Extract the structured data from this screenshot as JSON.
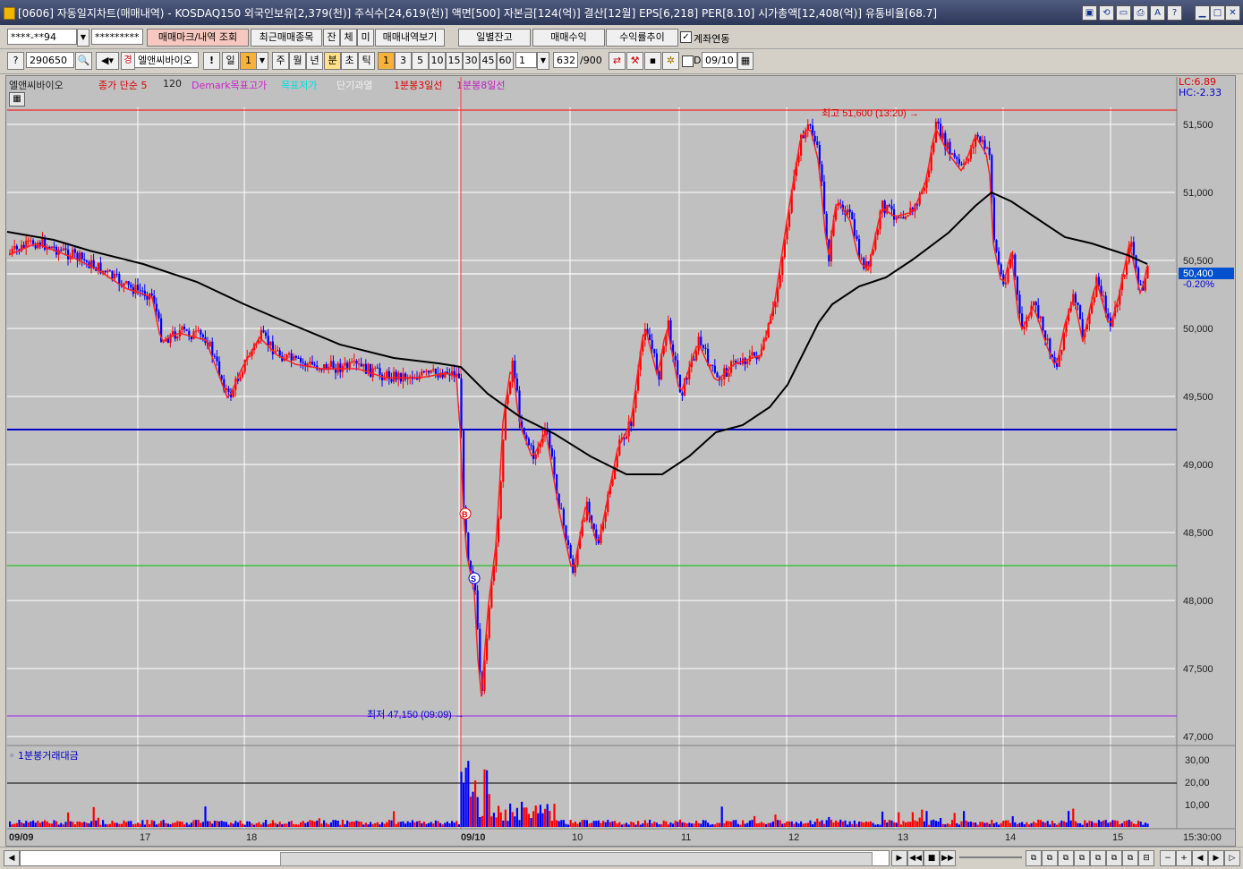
{
  "window": {
    "title": "[0606] 자동일지차트(매매내역) - KOSDAQ150 외국인보유[2,379(천)] 주식수[24,619(천)] 액면[500] 자본금[124(억)] 결산[12월] EPS[6,218] PER[8.10] 시가총액[12,408(억)] 유통비율[68.7]"
  },
  "toolbar1": {
    "account_value": "****-**94",
    "password_value": "*********",
    "btn_mark": "매매마크/내역 조회",
    "btn_recent": "최근매매종목",
    "btn_jan": "잔",
    "btn_che": "체",
    "btn_mi": "미",
    "btn_history": "매매내역보기",
    "btn_daily_balance": "일별잔고",
    "btn_trade_profit": "매매수익",
    "btn_return_trend": "수익률추이",
    "account_link_label": "계좌연동",
    "account_link_checked": "✓"
  },
  "toolbar2": {
    "code": "290650",
    "stock_name": "엘앤씨바이오",
    "periods": [
      "일",
      "1",
      "주",
      "월",
      "년",
      "분",
      "초",
      "틱"
    ],
    "minutes": [
      "1",
      "3",
      "5",
      "10",
      "15",
      "30",
      "45",
      "60"
    ],
    "interval_value": "1",
    "count_value": "632",
    "count_total": "/900",
    "d_label": "D",
    "date_value": "09/10"
  },
  "legend": [
    {
      "text": "엘앤씨바이오",
      "color": "#202020"
    },
    {
      "text": "종가 단순 5",
      "color": "#e00000"
    },
    {
      "text": "120",
      "color": "#202020"
    },
    {
      "text": "Demark목표고가",
      "color": "#d020d0"
    },
    {
      "text": "목표저가",
      "color": "#00e0e0"
    },
    {
      "text": "단기과열",
      "color": "#f0f0f0"
    },
    {
      "text": "1분봉3일선",
      "color": "#e00000"
    },
    {
      "text": "1분봉8일선",
      "color": "#c020c0"
    }
  ],
  "price_info": {
    "lc": "LC:6.89",
    "hc": "HC:-2.33",
    "current": "50,400",
    "change": "-0.20%"
  },
  "price_axis": [
    "51,500",
    "51,000",
    "50,500",
    "50,000",
    "49,500",
    "49,000",
    "48,500",
    "48,000",
    "47,500",
    "47,000"
  ],
  "annotations": {
    "high": "최고 51,600 (13:20)",
    "low": "최저 47,150 (09:09)",
    "buy_marker": "B",
    "sell_marker": "S"
  },
  "volume_panel": {
    "label": "1분봉거래대금",
    "axis": [
      "30,00",
      "20,00",
      "10,00"
    ]
  },
  "time_axis": [
    "09/09",
    "17",
    "18",
    "09/10",
    "10",
    "11",
    "12",
    "13",
    "14",
    "15"
  ],
  "end_time": "15:30:00",
  "colors": {
    "up": "#ff0000",
    "down": "#0000ff",
    "ma": "#000000",
    "hline_blue": "#0000c8",
    "hline_green": "#00c000",
    "hline_purple": "#a020f0",
    "hline_red": "#ff0000"
  },
  "chart_data": {
    "type": "candlestick",
    "price_range": [
      47000,
      51600
    ],
    "series": [
      {
        "name": "엘앤씨바이오",
        "x": [
          "09/09 09:00",
          "09/09 16:00",
          "09/09 17:00",
          "09/09 18:00",
          "09/10 09:00",
          "09/10 09:09",
          "09/10 09:30",
          "09/10 10:00",
          "09/10 11:00",
          "09/10 12:00",
          "09/10 13:20",
          "09/10 14:00",
          "09/10 15:00",
          "09/10 15:20"
        ],
        "values": [
          50650,
          50400,
          49900,
          49700,
          49700,
          47150,
          49700,
          48300,
          50000,
          51400,
          51600,
          50000,
          50300,
          50400
        ]
      },
      {
        "name": "120",
        "x": [
          "09/09 09:00",
          "09/09 18:00",
          "09/10 09:00",
          "09/10 10:00",
          "09/10 11:00",
          "09/10 12:00",
          "09/10 13:00",
          "09/10 13:40",
          "09/10 15:20"
        ],
        "values": [
          50700,
          50200,
          49750,
          48900,
          49050,
          49450,
          50300,
          50950,
          50450
        ]
      }
    ],
    "hlines": [
      51600,
      49250,
      48250,
      47150
    ],
    "volume": [
      1,
      3,
      2,
      1,
      3,
      2,
      5,
      26,
      32,
      20,
      10,
      8,
      6,
      5,
      6,
      8,
      5,
      4,
      6,
      8,
      7,
      5,
      4,
      6,
      8,
      6,
      5,
      7,
      9,
      5
    ],
    "volume_max": 32
  }
}
